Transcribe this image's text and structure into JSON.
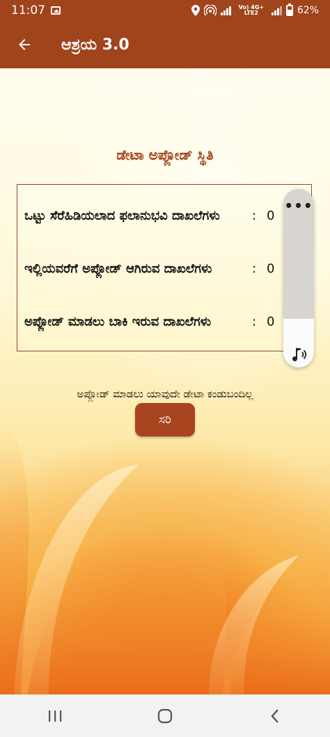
{
  "status_bar": {
    "time": "11:07",
    "network_label": "Vo) 4G+ LTE2",
    "battery": "62%"
  },
  "app_bar": {
    "title": "ಆಶ್ರಯ 3.0",
    "back_icon": "arrow-left-icon"
  },
  "main": {
    "section_title": "ಡೇಟಾ ಅಪ್ಲೋಡ್ ಸ್ಥಿತಿ",
    "stats": [
      {
        "label": "ಒಟ್ಟು ಸೆರೆಹಿಡಿಯಲಾದ ಫಲಾನುಭವಿ ದಾಖಲೆಗಳು",
        "colon": ":",
        "value": "0"
      },
      {
        "label": "ಇಲ್ಲಿಯವರೆಗೆ ಅಪ್ಲೋಡ್ ಆಗಿರುವ ದಾಖಲೆಗಳು",
        "colon": ":",
        "value": "0"
      },
      {
        "label": "ಅಪ್ಲೋಡ್ ಮಾಡಲು ಬಾಕಿ ಇರುವ ದಾಖಲೆಗಳು",
        "colon": ":",
        "value": "0"
      }
    ],
    "empty_message": "ಅಪ್ಲೋಡ್ ಮಾಡಲು ಯಾವುದೇ ಡೇಟಾ ಕಂಡುಬಂದಿಲ್ಲ",
    "ok_button": "ಸರಿ"
  },
  "audio_widget": {
    "more_label": "•••",
    "icon": "speaker-music-icon"
  },
  "nav_bar": {
    "recents_icon": "recents-icon",
    "home_icon": "home-icon",
    "back_icon": "back-chevron-icon"
  },
  "colors": {
    "primary": "#a0441c",
    "button": "#a94420"
  }
}
